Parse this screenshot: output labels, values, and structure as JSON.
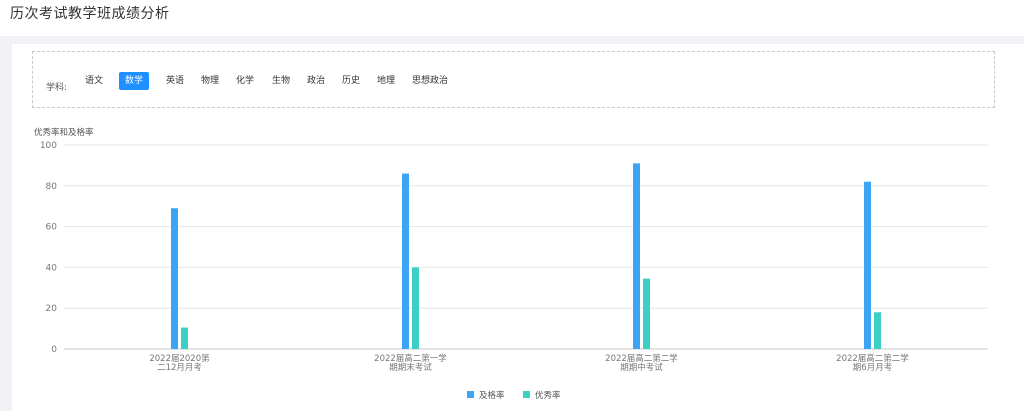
{
  "header": {
    "title": "历次考试教学班成绩分析"
  },
  "filter": {
    "label": "学科:",
    "subjects": [
      "语文",
      "数学",
      "英语",
      "物理",
      "化学",
      "生物",
      "政治",
      "历史",
      "地理",
      "思想政治"
    ],
    "active": "数学"
  },
  "chart_data": {
    "type": "bar",
    "ylabel": "优秀率和及格率",
    "ylim": [
      0,
      100
    ],
    "yticks": [
      0,
      20,
      40,
      60,
      80,
      100
    ],
    "grid": true,
    "legend_position": "bottom-center",
    "categories": [
      [
        "2022届2020第",
        "二12月月考"
      ],
      [
        "2022届高二第一学",
        "期期末考试"
      ],
      [
        "2022届高二第二学",
        "期期中考试"
      ],
      [
        "2022届高二第二学",
        "期6月月考"
      ]
    ],
    "series": [
      {
        "name": "及格率",
        "color": "#3ba4f4",
        "values": [
          69,
          86,
          91,
          82
        ]
      },
      {
        "name": "优秀率",
        "color": "#3ccfc3",
        "values": [
          10.5,
          40,
          34.5,
          18
        ]
      }
    ]
  }
}
